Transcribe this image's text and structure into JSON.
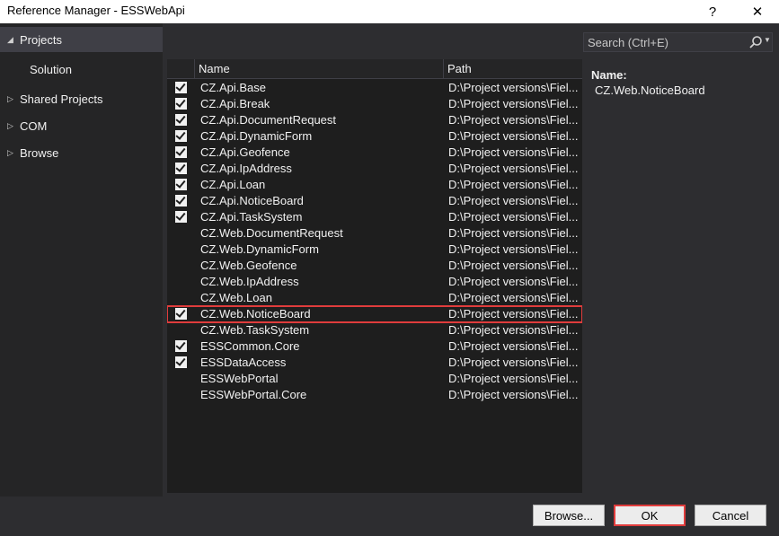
{
  "window": {
    "title": "Reference Manager - ESSWebApi",
    "help_glyph": "?",
    "close_glyph": "✕"
  },
  "nav": {
    "projects": "Projects",
    "solution": "Solution",
    "shared_projects": "Shared Projects",
    "com": "COM",
    "browse": "Browse"
  },
  "search": {
    "placeholder": "Search (Ctrl+E)"
  },
  "list": {
    "header_name": "Name",
    "header_path": "Path",
    "rows": [
      {
        "checked": true,
        "name": "CZ.Api.Base",
        "path": "D:\\Project versions\\Fiel..."
      },
      {
        "checked": true,
        "name": "CZ.Api.Break",
        "path": "D:\\Project versions\\Fiel..."
      },
      {
        "checked": true,
        "name": "CZ.Api.DocumentRequest",
        "path": "D:\\Project versions\\Fiel..."
      },
      {
        "checked": true,
        "name": "CZ.Api.DynamicForm",
        "path": "D:\\Project versions\\Fiel..."
      },
      {
        "checked": true,
        "name": "CZ.Api.Geofence",
        "path": "D:\\Project versions\\Fiel..."
      },
      {
        "checked": true,
        "name": "CZ.Api.IpAddress",
        "path": "D:\\Project versions\\Fiel..."
      },
      {
        "checked": true,
        "name": "CZ.Api.Loan",
        "path": "D:\\Project versions\\Fiel..."
      },
      {
        "checked": true,
        "name": "CZ.Api.NoticeBoard",
        "path": "D:\\Project versions\\Fiel..."
      },
      {
        "checked": true,
        "name": "CZ.Api.TaskSystem",
        "path": "D:\\Project versions\\Fiel..."
      },
      {
        "checked": false,
        "name": "CZ.Web.DocumentRequest",
        "path": "D:\\Project versions\\Fiel..."
      },
      {
        "checked": false,
        "name": "CZ.Web.DynamicForm",
        "path": "D:\\Project versions\\Fiel..."
      },
      {
        "checked": false,
        "name": "CZ.Web.Geofence",
        "path": "D:\\Project versions\\Fiel..."
      },
      {
        "checked": false,
        "name": "CZ.Web.IpAddress",
        "path": "D:\\Project versions\\Fiel..."
      },
      {
        "checked": false,
        "name": "CZ.Web.Loan",
        "path": "D:\\Project versions\\Fiel..."
      },
      {
        "checked": true,
        "name": "CZ.Web.NoticeBoard",
        "path": "D:\\Project versions\\Fiel...",
        "highlighted": true
      },
      {
        "checked": false,
        "name": "CZ.Web.TaskSystem",
        "path": "D:\\Project versions\\Fiel..."
      },
      {
        "checked": true,
        "name": "ESSCommon.Core",
        "path": "D:\\Project versions\\Fiel..."
      },
      {
        "checked": true,
        "name": "ESSDataAccess",
        "path": "D:\\Project versions\\Fiel..."
      },
      {
        "checked": false,
        "name": "ESSWebPortal",
        "path": "D:\\Project versions\\Fiel..."
      },
      {
        "checked": false,
        "name": "ESSWebPortal.Core",
        "path": "D:\\Project versions\\Fiel..."
      }
    ]
  },
  "details": {
    "label": "Name:",
    "value": "CZ.Web.NoticeBoard"
  },
  "buttons": {
    "browse": "Browse...",
    "ok": "OK",
    "cancel": "Cancel"
  },
  "colors": {
    "highlight_border": "#e03c3c",
    "background": "#2d2d30"
  }
}
